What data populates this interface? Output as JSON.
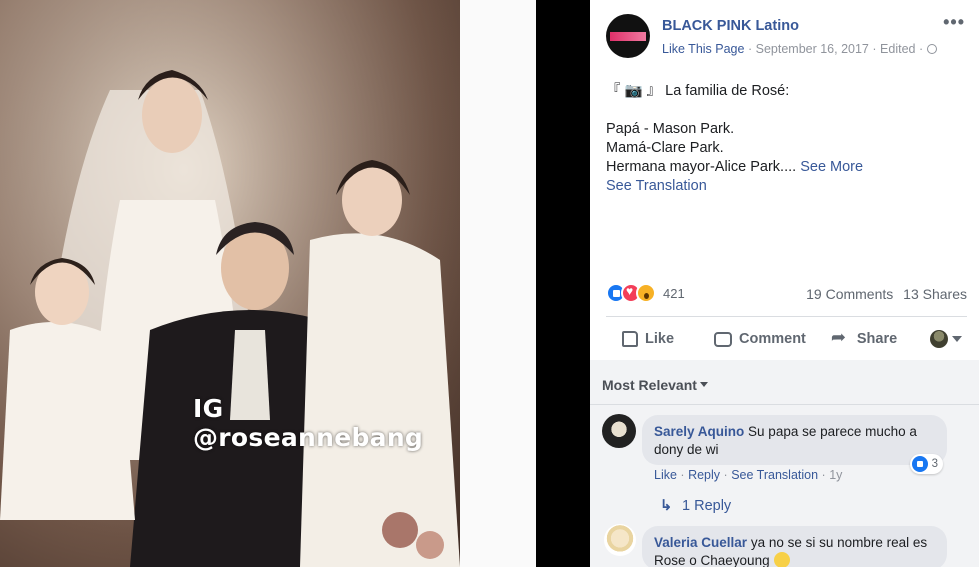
{
  "photo": {
    "watermark": "IG @roseannebang"
  },
  "post": {
    "page_name": "BLACK PINK Latino",
    "like_page": "Like This Page",
    "date": "September 16, 2017",
    "edited": "Edited",
    "meta_sep": "·",
    "more": "•••",
    "text_lines": [
      "『 📷 』 La familia de Rosé:",
      "",
      "Papá - Mason Park.",
      "Mamá-Clare Park.",
      "Hermana mayor-Alice Park...."
    ],
    "see_more": "See More",
    "see_translation": "See Translation",
    "reaction_count": "421",
    "comments_count": "19 Comments",
    "shares_count": "13 Shares",
    "actions": {
      "like": "Like",
      "comment": "Comment",
      "share": "Share"
    }
  },
  "comments": {
    "sort_label": "Most Relevant",
    "items": [
      {
        "author": "Sarely Aquino",
        "text": "Su papa se parece mucho a dony de wi",
        "like": "Like",
        "reply": "Reply",
        "see_translation": "See Translation",
        "time": "1y",
        "reactions": "3",
        "replies": "1 Reply"
      },
      {
        "author": "Valeria Cuellar",
        "text": "ya no se si su nombre real es Rose o Chaeyoung"
      }
    ]
  }
}
